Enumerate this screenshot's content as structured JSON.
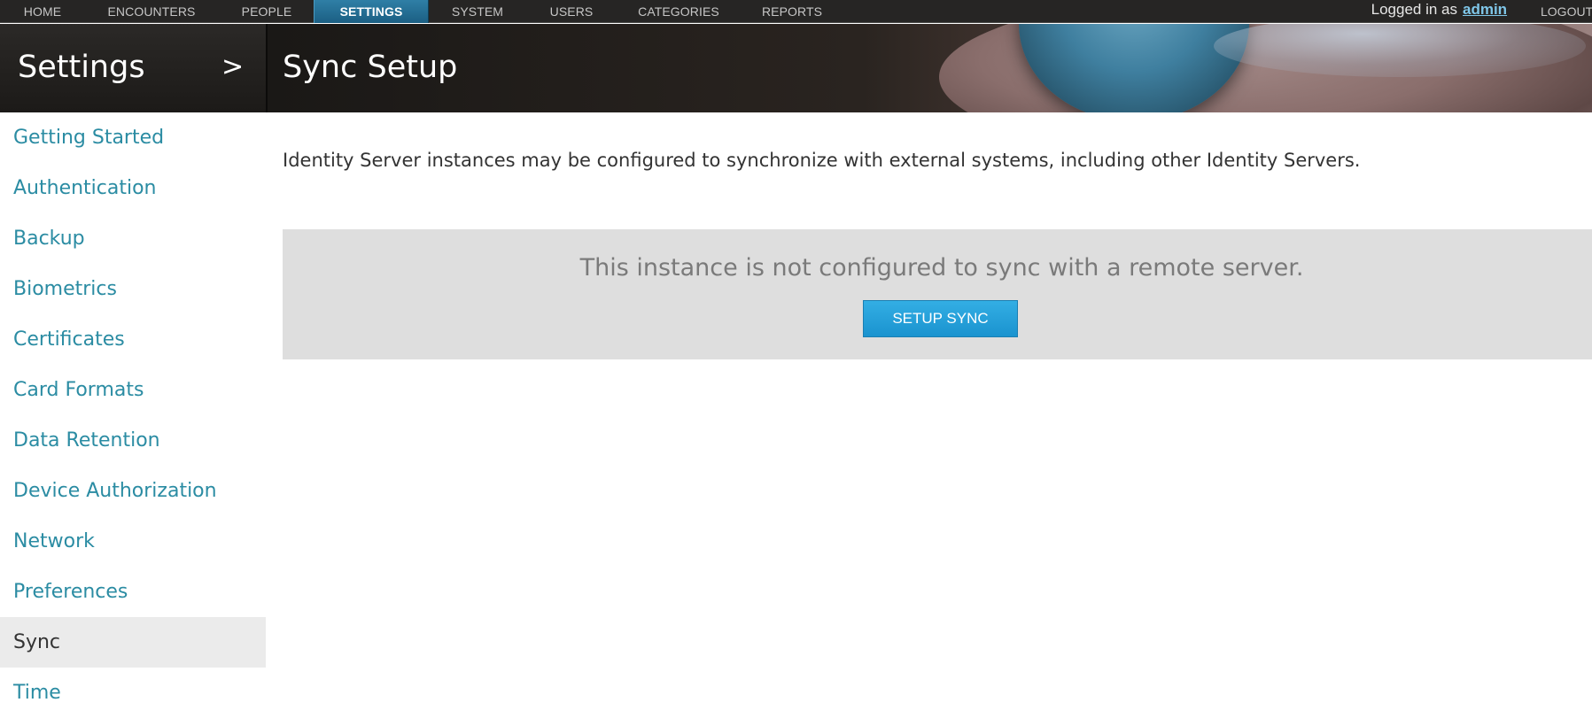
{
  "nav": {
    "items": [
      {
        "label": "HOME"
      },
      {
        "label": "ENCOUNTERS"
      },
      {
        "label": "PEOPLE"
      },
      {
        "label": "SETTINGS"
      },
      {
        "label": "SYSTEM"
      },
      {
        "label": "USERS"
      },
      {
        "label": "CATEGORIES"
      },
      {
        "label": "REPORTS"
      }
    ],
    "active": "SETTINGS",
    "login_prefix": "Logged in as",
    "username": "admin",
    "logout_label": "LOGOUT"
  },
  "banner": {
    "section_title": "Settings",
    "chevron": ">",
    "page_title": "Sync Setup"
  },
  "sidebar": {
    "items": [
      {
        "label": "Getting Started"
      },
      {
        "label": "Authentication"
      },
      {
        "label": "Backup"
      },
      {
        "label": "Biometrics"
      },
      {
        "label": "Certificates"
      },
      {
        "label": "Card Formats"
      },
      {
        "label": "Data Retention"
      },
      {
        "label": "Device Authorization"
      },
      {
        "label": "Network"
      },
      {
        "label": "Preferences"
      },
      {
        "label": "Sync"
      },
      {
        "label": "Time"
      }
    ],
    "active": "Sync"
  },
  "main": {
    "intro": "Identity Server instances may be configured to synchronize with external systems, including other Identity Servers.",
    "notice": "This instance is not configured to sync with a remote server.",
    "setup_button_label": "SETUP SYNC"
  },
  "colors": {
    "accent": "#1a93cf",
    "link": "#2b8ca3",
    "nav_bg": "#262524",
    "nav_active": "#1b5f83",
    "panel_bg": "#dedede"
  }
}
